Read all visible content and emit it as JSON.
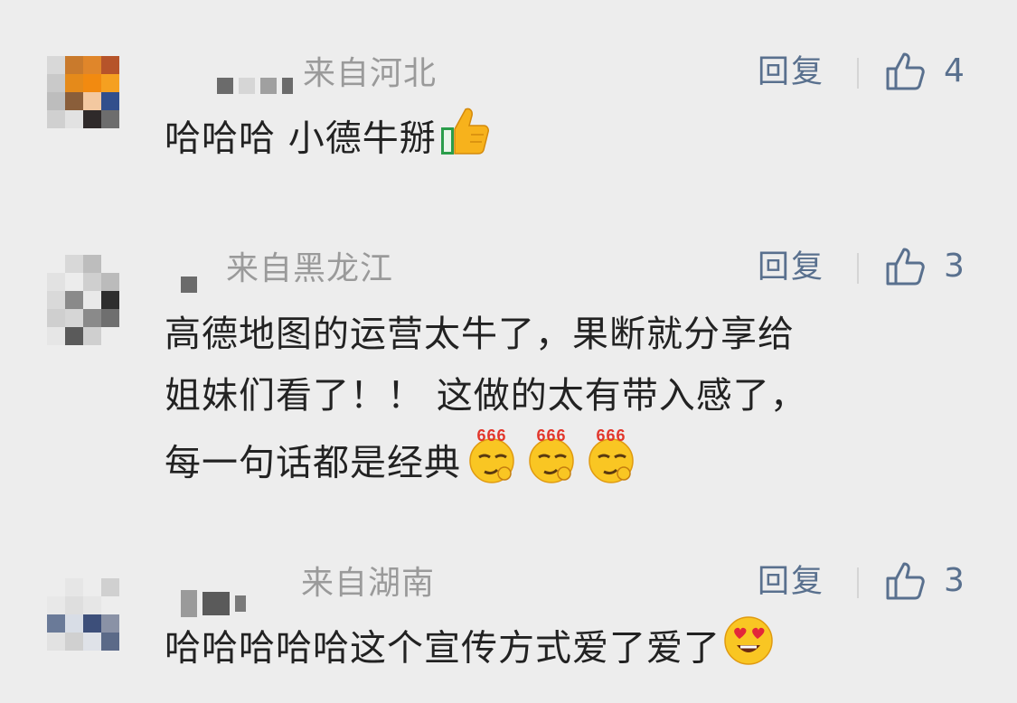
{
  "comments": [
    {
      "region": "来自河北",
      "reply_label": "回复",
      "like_count": "4",
      "text": "哈哈哈 小德牛掰",
      "emojis": [
        "thumbs-up-icon"
      ]
    },
    {
      "region": "来自黑龙江",
      "reply_label": "回复",
      "like_count": "3",
      "text_lines": [
        "高德地图的运营太牛了，果断就分享给",
        "姐妹们看了！！ 这做的太有带入感了，",
        "每一句话都是经典"
      ],
      "emojis": [
        "666-smug-icon",
        "666-smug-icon",
        "666-smug-icon"
      ],
      "emoji_badge": "666"
    },
    {
      "region": "来自湖南",
      "reply_label": "回复",
      "like_count": "3",
      "text": "哈哈哈哈哈这个宣传方式爱了爱了",
      "emojis": [
        "heart-eyes-icon"
      ]
    }
  ],
  "colors": {
    "background": "#ededed",
    "link": "#59708e",
    "region": "#9a9a9a",
    "text": "#222222"
  }
}
